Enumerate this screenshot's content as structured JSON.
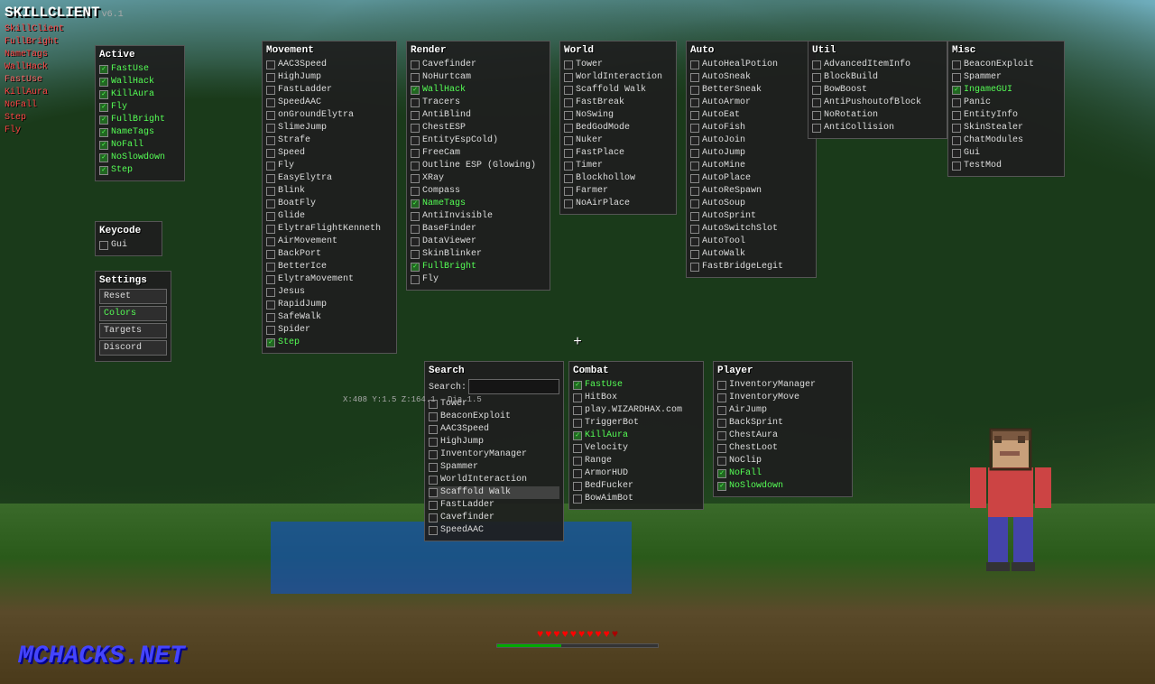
{
  "app": {
    "title": "SKILLCLIENT",
    "version": "v6.1"
  },
  "sidebar": {
    "links": [
      {
        "label": "SkillClient",
        "active": false
      },
      {
        "label": "FullBright",
        "active": false
      },
      {
        "label": "NameTags",
        "active": false
      },
      {
        "label": "WallHack",
        "active": false
      },
      {
        "label": "FastUse",
        "active": true
      },
      {
        "label": "KillAura",
        "active": false
      },
      {
        "label": "NoFall",
        "active": false
      },
      {
        "label": "Step",
        "active": false
      },
      {
        "label": "Fly",
        "active": false
      }
    ]
  },
  "active_panel": {
    "title": "Active",
    "items": [
      {
        "label": "FastUse",
        "checked": true
      },
      {
        "label": "WallHack",
        "checked": true
      },
      {
        "label": "KillAura",
        "checked": true
      },
      {
        "label": "Fly",
        "checked": true
      },
      {
        "label": "FullBright",
        "checked": true
      },
      {
        "label": "NameTags",
        "checked": true
      },
      {
        "label": "NoFall",
        "checked": true
      },
      {
        "label": "NoSlowdown",
        "checked": true
      },
      {
        "label": "Step",
        "checked": true
      }
    ]
  },
  "keycode_panel": {
    "title": "Keycode",
    "items": [
      {
        "label": "Gui",
        "checked": false
      }
    ]
  },
  "settings_panel": {
    "title": "Settings",
    "buttons": [
      "Reset",
      "Colors",
      "Targets",
      "Discord"
    ]
  },
  "movement_panel": {
    "title": "Movement",
    "items": [
      {
        "label": "AAC3Speed",
        "checked": false
      },
      {
        "label": "HighJump",
        "checked": false
      },
      {
        "label": "FastLadder",
        "checked": false
      },
      {
        "label": "SpeedAAC",
        "checked": false
      },
      {
        "label": "onGroundElytra",
        "checked": false
      },
      {
        "label": "SlimeJump",
        "checked": false
      },
      {
        "label": "Strafe",
        "checked": false
      },
      {
        "label": "Speed",
        "checked": false
      },
      {
        "label": "Fly",
        "checked": false
      },
      {
        "label": "EasyElytra",
        "checked": false
      },
      {
        "label": "Blink",
        "checked": false
      },
      {
        "label": "BoatFly",
        "checked": false
      },
      {
        "label": "Glide",
        "checked": false
      },
      {
        "label": "ElytraFlightKenneth",
        "checked": false
      },
      {
        "label": "AirMovement",
        "checked": false
      },
      {
        "label": "BackPort",
        "checked": false
      },
      {
        "label": "BetterIce",
        "checked": false
      },
      {
        "label": "ElytraMovement",
        "checked": false
      },
      {
        "label": "Jesus",
        "checked": false
      },
      {
        "label": "RapidJump",
        "checked": false
      },
      {
        "label": "SafeWalk",
        "checked": false
      },
      {
        "label": "Spider",
        "checked": false
      },
      {
        "label": "Step",
        "checked": true
      }
    ]
  },
  "render_panel": {
    "title": "Render",
    "items": [
      {
        "label": "Cavefinder",
        "checked": false
      },
      {
        "label": "NoHurtcam",
        "checked": false
      },
      {
        "label": "WallHack",
        "checked": true
      },
      {
        "label": "Tracers",
        "checked": false
      },
      {
        "label": "AntiBlind",
        "checked": false
      },
      {
        "label": "ChestESP",
        "checked": false
      },
      {
        "label": "EntityEspCold)",
        "checked": false
      },
      {
        "label": "FreeCam",
        "checked": false
      },
      {
        "label": "Outline ESP (Glowing)",
        "checked": false
      },
      {
        "label": "XRay",
        "checked": false
      },
      {
        "label": "Compass",
        "checked": false
      },
      {
        "label": "NameTags",
        "checked": true
      },
      {
        "label": "AntiInvisible",
        "checked": false
      },
      {
        "label": "BaseFinder",
        "checked": false
      },
      {
        "label": "DataViewer",
        "checked": false
      },
      {
        "label": "SkinBlinker",
        "checked": false
      },
      {
        "label": "Fly",
        "checked": false
      },
      {
        "label": "FullBright",
        "checked": true
      }
    ]
  },
  "world_panel": {
    "title": "World",
    "items": [
      {
        "label": "Tower",
        "checked": false
      },
      {
        "label": "WorldInteraction",
        "checked": false
      },
      {
        "label": "Scaffold Walk",
        "checked": false
      },
      {
        "label": "FastBreak",
        "checked": false
      },
      {
        "label": "NoSwing",
        "checked": false
      },
      {
        "label": "BedGodMode",
        "checked": false
      },
      {
        "label": "Nuker",
        "checked": false
      },
      {
        "label": "FastPlace",
        "checked": false
      },
      {
        "label": "Timer",
        "checked": false
      },
      {
        "label": "Blockhollow",
        "checked": false
      },
      {
        "label": "Farmer",
        "checked": false
      },
      {
        "label": "NoAirPlace",
        "checked": false
      }
    ]
  },
  "auto_panel": {
    "title": "Auto",
    "items": [
      {
        "label": "AutoHealPotion",
        "checked": false
      },
      {
        "label": "AutoSneak",
        "checked": false
      },
      {
        "label": "BetterSneak",
        "checked": false
      },
      {
        "label": "AutoArmor",
        "checked": false
      },
      {
        "label": "AutoEat",
        "checked": false
      },
      {
        "label": "AutoFish",
        "checked": false
      },
      {
        "label": "AutoJoin",
        "checked": false
      },
      {
        "label": "AutoJump",
        "checked": false
      },
      {
        "label": "AutoMine",
        "checked": false
      },
      {
        "label": "AutoPlace",
        "checked": false
      },
      {
        "label": "AutoReSpawn",
        "checked": false
      },
      {
        "label": "AutoSoup",
        "checked": false
      },
      {
        "label": "AutoSprint",
        "checked": false
      },
      {
        "label": "AutoSwitchSlot",
        "checked": false
      },
      {
        "label": "AutoTool",
        "checked": false
      },
      {
        "label": "AutoWalk",
        "checked": false
      },
      {
        "label": "FastBridgeLegit",
        "checked": false
      }
    ]
  },
  "util_panel": {
    "title": "Util",
    "items": [
      {
        "label": "AdvancedItemInfo",
        "checked": false
      },
      {
        "label": "BlockBuild",
        "checked": false
      },
      {
        "label": "BowBoost",
        "checked": false
      },
      {
        "label": "AntiPushoutofBlock",
        "checked": false
      },
      {
        "label": "NoRotation",
        "checked": false
      },
      {
        "label": "AntiCollision",
        "checked": false
      }
    ]
  },
  "misc_panel": {
    "title": "Misc",
    "items": [
      {
        "label": "BeaconExploit",
        "checked": false
      },
      {
        "label": "Spammer",
        "checked": false
      },
      {
        "label": "IngameGUI",
        "checked": true
      },
      {
        "label": "Panic",
        "checked": false
      },
      {
        "label": "EntityInfo",
        "checked": false
      },
      {
        "label": "SkinStealer",
        "checked": false
      },
      {
        "label": "ChatModules",
        "checked": false
      },
      {
        "label": "Gui",
        "checked": false
      },
      {
        "label": "TestMod",
        "checked": false
      }
    ]
  },
  "search_panel": {
    "title": "Search",
    "placeholder": "Search:",
    "items": [
      {
        "label": "Tower",
        "checked": false,
        "highlight": false
      },
      {
        "label": "BeaconExploit",
        "checked": false,
        "highlight": false
      },
      {
        "label": "AAC3Speed",
        "checked": false,
        "highlight": false
      },
      {
        "label": "HighJump",
        "checked": false,
        "highlight": false
      },
      {
        "label": "InventoryManager",
        "checked": false,
        "highlight": false
      },
      {
        "label": "Spammer",
        "checked": false,
        "highlight": false
      },
      {
        "label": "WorldInteraction",
        "checked": false,
        "highlight": false
      },
      {
        "label": "Scaffold Walk",
        "checked": false,
        "highlight": true
      },
      {
        "label": "FastLadder",
        "checked": false,
        "highlight": false
      },
      {
        "label": "Cavefinder",
        "checked": false,
        "highlight": false
      },
      {
        "label": "SpeedAAC",
        "checked": false,
        "highlight": false
      }
    ]
  },
  "combat_panel": {
    "title": "Combat",
    "items": [
      {
        "label": "FastUse",
        "checked": true
      },
      {
        "label": "HitBox",
        "checked": false
      },
      {
        "label": "play.WIZARDHAX.com",
        "checked": false
      },
      {
        "label": "TriggerBot",
        "checked": false
      },
      {
        "label": "KillAura",
        "checked": true
      },
      {
        "label": "Velocity",
        "checked": false
      },
      {
        "label": "Range",
        "checked": false
      },
      {
        "label": "ArmorHUD",
        "checked": false
      },
      {
        "label": "BedFucker",
        "checked": false
      },
      {
        "label": "BowAimBot",
        "checked": false
      }
    ]
  },
  "player_panel": {
    "title": "Player",
    "items": [
      {
        "label": "InventoryManager",
        "checked": false
      },
      {
        "label": "InventoryMove",
        "checked": false
      },
      {
        "label": "AirJump",
        "checked": false
      },
      {
        "label": "BackSprint",
        "checked": false
      },
      {
        "label": "ChestAura",
        "checked": false
      },
      {
        "label": "ChestLoot",
        "checked": false
      },
      {
        "label": "NoClip",
        "checked": false
      },
      {
        "label": "NoFall",
        "checked": true
      },
      {
        "label": "NoSlowdown",
        "checked": true
      }
    ]
  },
  "hud": {
    "crosshair": "+",
    "coords": "X:408.68 Y:1.5 Z:164.1",
    "mchacks": "MCHACKS.NET",
    "hearts": 10
  }
}
